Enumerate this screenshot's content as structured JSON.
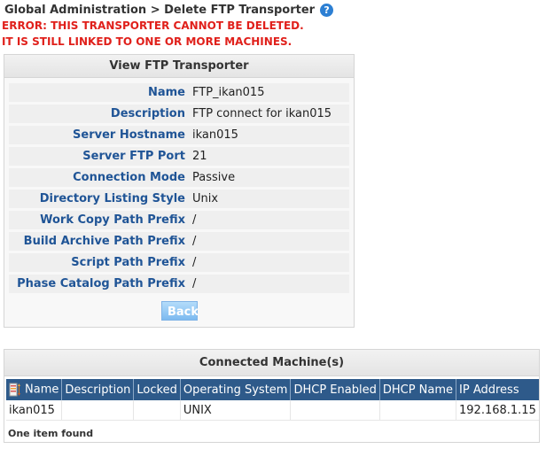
{
  "breadcrumb": {
    "text": "Global Administration > Delete FTP Transporter"
  },
  "help": {
    "glyph": "?"
  },
  "errors": [
    "ERROR: THIS TRANSPORTER CANNOT BE DELETED.",
    "IT IS STILL LINKED TO ONE OR MORE MACHINES."
  ],
  "transporter_panel": {
    "title": "View FTP Transporter",
    "fields": [
      {
        "label": "Name",
        "value": "FTP_ikan015"
      },
      {
        "label": "Description",
        "value": "FTP connect for ikan015"
      },
      {
        "label": "Server Hostname",
        "value": "ikan015"
      },
      {
        "label": "Server FTP Port",
        "value": "21"
      },
      {
        "label": "Connection Mode",
        "value": "Passive"
      },
      {
        "label": "Directory Listing Style",
        "value": "Unix"
      },
      {
        "label": "Work Copy Path Prefix",
        "value": "/"
      },
      {
        "label": "Build Archive Path Prefix",
        "value": "/"
      },
      {
        "label": "Script Path Prefix",
        "value": "/"
      },
      {
        "label": "Phase Catalog Path Prefix",
        "value": "/"
      }
    ],
    "back_label": "Back"
  },
  "machines_panel": {
    "title": "Connected Machine(s)",
    "columns": [
      "Name",
      "Description",
      "Locked",
      "Operating System",
      "DHCP Enabled",
      "DHCP Name",
      "IP Address"
    ],
    "rows": [
      [
        "ikan015",
        "",
        "",
        "UNIX",
        "",
        "",
        "192.168.1.15"
      ]
    ],
    "footer": "One item found"
  }
}
